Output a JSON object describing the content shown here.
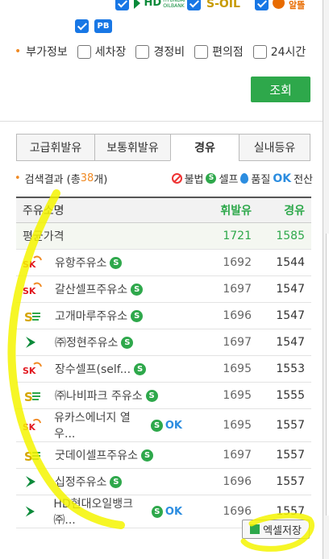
{
  "brands_top": [
    {
      "label": "HD",
      "sub": "HYUNDAI OILBANK",
      "color": "#0b8a3a"
    },
    {
      "label": "S-OIL",
      "color": "#c79b00"
    },
    {
      "label": "알뜰",
      "color": "#e86b00"
    },
    {
      "label": "PB",
      "color": "#1877e5"
    }
  ],
  "options": {
    "label": "부가정보",
    "items": [
      "세차장",
      "경정비",
      "편의점",
      "24시간"
    ]
  },
  "search_button": "조회",
  "tabs": [
    "고급휘발유",
    "보통휘발유",
    "경유",
    "실내등유"
  ],
  "results": {
    "label_prefix": "검색결과 (총 ",
    "count": "38",
    "label_suffix": "개)",
    "legend": [
      "불법",
      "셀프",
      "품질",
      "전산"
    ]
  },
  "table": {
    "headers": [
      "주유소명",
      "휘발유",
      "경유"
    ],
    "average": {
      "name": "평균가격",
      "gasoline": "1721",
      "diesel": "1585"
    },
    "rows": [
      {
        "brand": "SK",
        "name": "유항주유소",
        "self": true,
        "ok": false,
        "gasoline": "1692",
        "diesel": "1544"
      },
      {
        "brand": "SK",
        "name": "갈산셀프주유소",
        "self": true,
        "ok": false,
        "gasoline": "1697",
        "diesel": "1547"
      },
      {
        "brand": "S-OIL",
        "name": "고개마루주유소",
        "self": true,
        "ok": false,
        "gasoline": "1696",
        "diesel": "1547"
      },
      {
        "brand": "HD",
        "name": "㈜정현주유소",
        "self": true,
        "ok": false,
        "gasoline": "1697",
        "diesel": "1547"
      },
      {
        "brand": "SK",
        "name": "장수셀프(self...",
        "self": true,
        "ok": false,
        "gasoline": "1695",
        "diesel": "1553"
      },
      {
        "brand": "S-OIL",
        "name": "㈜나비파크 주유소",
        "self": true,
        "ok": false,
        "gasoline": "1695",
        "diesel": "1555"
      },
      {
        "brand": "SK",
        "name": "유카스에너지 열우...",
        "self": true,
        "ok": true,
        "gasoline": "1695",
        "diesel": "1557"
      },
      {
        "brand": "S-OIL",
        "name": "굿데이셀프주유소",
        "self": true,
        "ok": false,
        "gasoline": "1697",
        "diesel": "1557"
      },
      {
        "brand": "HD",
        "name": "십정주유소",
        "self": true,
        "ok": false,
        "gasoline": "1696",
        "diesel": "1557"
      },
      {
        "brand": "HD",
        "name": "HD현대오일뱅크㈜...",
        "self": true,
        "ok": true,
        "gasoline": "1696",
        "diesel": "1557"
      }
    ]
  },
  "excel_button": "엑셀저장",
  "colors": {
    "accent_green": "#2ea84b",
    "highlight_orange": "#f08a24",
    "annotation_yellow": "#f5f500"
  }
}
